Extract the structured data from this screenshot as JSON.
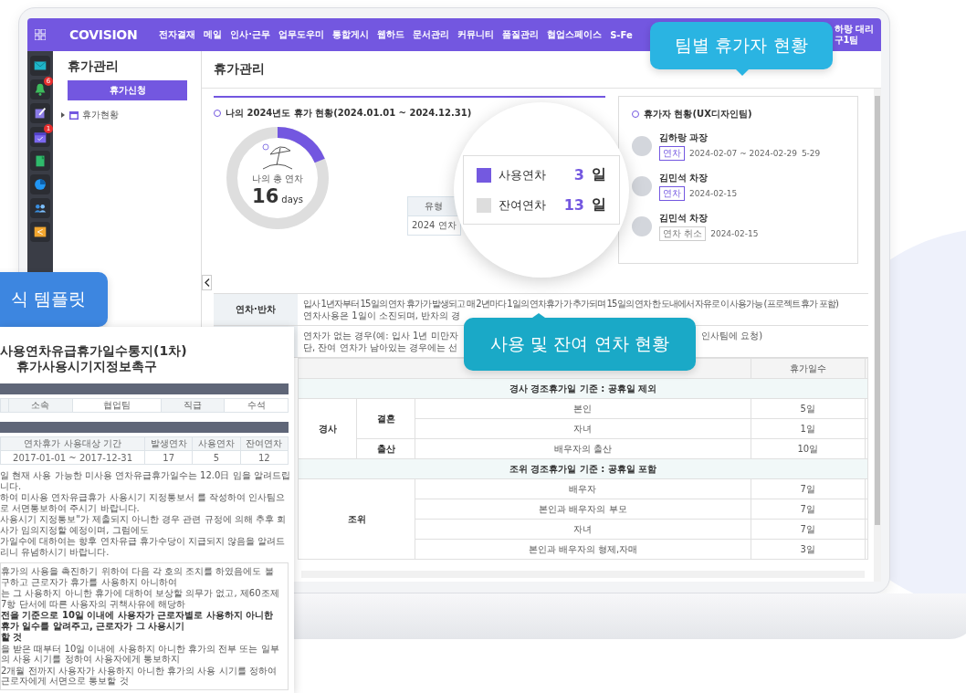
{
  "nav": {
    "logo": "COVISION",
    "items": [
      "전자결재",
      "메일",
      "인사·근무",
      "업무도우미",
      "통합게시",
      "웹하드",
      "문서관리",
      "커뮤니티",
      "품질관리",
      "협업스페이스",
      "S-Fe"
    ],
    "user_name": "하랑 대리",
    "user_team": "구1팀"
  },
  "rail": [
    {
      "kind": "mail"
    },
    {
      "kind": "bell",
      "badge": "6"
    },
    {
      "kind": "edit"
    },
    {
      "kind": "calendar",
      "badge": "1"
    },
    {
      "kind": "note"
    },
    {
      "kind": "chart"
    },
    {
      "kind": "contacts"
    },
    {
      "kind": "share"
    }
  ],
  "side_panel": {
    "title": "휴가관리",
    "apply_button": "휴가신청",
    "tree": [
      {
        "label": "휴가현황",
        "expanded": false
      }
    ]
  },
  "main": {
    "title": "휴가관리"
  },
  "my_leave": {
    "heading": "나의 2024년도 휴가 현황(2024.01.01 ~ 2024.12.31)",
    "total_label": "나의 총 연차",
    "total_value": "16",
    "total_unit": "days",
    "level": 0.1875,
    "mini_header": "유형",
    "mini_cell": "2024 연차"
  },
  "legend": [
    {
      "label": "사용연차",
      "value": "3",
      "unit": "일",
      "color": "#7459e0"
    },
    {
      "label": "잔여연차",
      "value": "13",
      "unit": "일",
      "color": "#dddddd"
    }
  ],
  "team_leave": {
    "heading": "휴가자 현황(UX디자인팀)",
    "people": [
      {
        "name": "김하랑 과장",
        "tag": "연차",
        "kind": "leave",
        "period": "2024-02-07 ~ 2024-02-29",
        "extra": "5-29"
      },
      {
        "name": "김민석 차장",
        "tag": "연차",
        "kind": "leave",
        "period": "2024-02-15"
      },
      {
        "name": "김민석 차장",
        "tag": "연차 취소",
        "kind": "cancel",
        "period": "2024-02-15"
      }
    ]
  },
  "policy_rows": [
    {
      "label": "연차·반차",
      "lines": [
        {
          "text": "입사 1년자부터 15일의 연차 휴가가 발생되고 매 2년마다 1일의 연차휴가가 추가되며 15일의 연차 한도내에서 자유로이 사용가능 (프로젝트 휴가 포함)",
          "full": true
        },
        {
          "text": "연차사용은 1일이 소진되며, 반차의 경"
        }
      ]
    },
    {
      "label": "",
      "lines": [
        {
          "text": "연차가 없는 경우(예: 입사 1년 미만자",
          "after": "인사팀에 요청)"
        },
        {
          "text": "단, 잔여 연차가 남아있는 경우에는 선"
        }
      ]
    }
  ],
  "leave_table": {
    "days_header": "휴가일수",
    "sections": [
      {
        "heading": "경사 경조휴가일 기준 : 공휴일 제외",
        "category": "경사",
        "subgroups": [
          {
            "name": "결혼",
            "items": [
              {
                "target": "본인",
                "days": "5일"
              },
              {
                "target": "자녀",
                "days": "1일"
              }
            ]
          },
          {
            "name": "출산",
            "items": [
              {
                "target": "배우자의 출산",
                "days": "10일"
              }
            ]
          }
        ]
      },
      {
        "heading": "조위 경조휴가일 기준 : 공휴일 포함",
        "category": "조위",
        "subgroups": [
          {
            "items": [
              {
                "target": "배우자",
                "days": "7일"
              },
              {
                "target": "본인과 배우자의 부모",
                "days": "7일"
              },
              {
                "target": "자녀",
                "days": "7일"
              },
              {
                "target": "본인과 배우자의 형제,자매",
                "days": "3일"
              }
            ]
          }
        ]
      }
    ]
  },
  "callouts": [
    {
      "text": "팀별 휴가자 현황",
      "kind": "down"
    },
    {
      "text": "사용 및 잔여 연차 현황",
      "kind": "up"
    },
    {
      "text": "식 템플릿",
      "kind": "plain"
    }
  ],
  "document": {
    "title_lines": [
      "사용연차유급휴가일수통지(1차)",
      "휴가사용시기지정보촉구"
    ],
    "info_row": [
      "소속",
      "협업팀",
      "직급",
      "수석"
    ],
    "table_header": [
      "연차휴가 사용대상 기간",
      "발생연차",
      "사용연차",
      "잔여연차"
    ],
    "table_row": [
      "2017-01-01 ~ 2017-12-31",
      "17",
      "5",
      "12"
    ],
    "paragraphs": [
      "일 현재 사용 가능한 미사용 연차유급휴가일수는 12.0日 임을 알려드립니다.",
      "하여 미사용 연차유급휴가 사용시기 지정통보서 를 작성하여 인사팀으로 서면통보하여 주시기 바랍니다.",
      "사용시기 지정통보\"가 제출되지 아니한 경우 관련 규정에 의해 추후 회사가 임의지정할 예정이며, 그럼에도",
      "가일수에 대하여는 향후 연차유급 휴가수당이 지급되지 않음을 알려드리니 유념하시기 바랍니다."
    ],
    "box_lines": [
      {
        "text": "휴가의 사용을 촉진하기 위하여 다음 각 호의 조치를 하였음에도 불구하고 근로자가 휴가를 사용하지 아니하여",
        "bold": false
      },
      {
        "text": "는 그 사용하지 아니한 휴가에 대하여 보상할 의무가 없고, 제60조제7항 단서에 따른 사용자의 귀책사유에 해당하",
        "bold": false
      },
      {
        "text": "전을 기준으로 10일 이내에 사용자가 근로자별로 사용하지 아니한 휴가 일수를 알려주고, 근로자가 그 사용시기",
        "bold": true
      },
      {
        "text": "할 것",
        "bold": true
      },
      {
        "text": "을 받은 때부터 10일 이내에 사용하지 아니한 휴가의 전부 또는 일부의 사용 시기를 정하여 사용자에게 통보하지",
        "bold": false
      },
      {
        "text": "2개월 전까지 사용자가 사용하지 아니한 휴가의 사용 시기를 정하여 근로자에게 서면으로 통보할 것",
        "bold": false
      }
    ]
  }
}
